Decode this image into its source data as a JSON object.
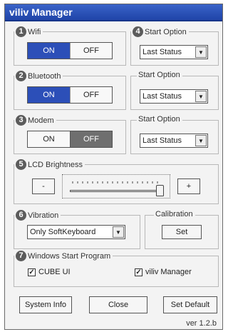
{
  "title": "viliv Manager",
  "wifi": {
    "num": "1",
    "label": "Wifi",
    "on": "ON",
    "off": "OFF",
    "state": "on"
  },
  "wifi_start": {
    "num": "4",
    "label": "Start Option",
    "value": "Last Status"
  },
  "bluetooth": {
    "num": "2",
    "label": "Bluetooth",
    "on": "ON",
    "off": "OFF",
    "state": "on"
  },
  "bluetooth_start": {
    "label": "Start Option",
    "value": "Last Status"
  },
  "modem": {
    "num": "3",
    "label": "Modem",
    "on": "ON",
    "off": "OFF",
    "state": "off"
  },
  "modem_start": {
    "label": "Start Option",
    "value": "Last Status"
  },
  "lcd": {
    "num": "5",
    "label": "LCD Brightness",
    "minus": "-",
    "plus": "+",
    "level": 1.0
  },
  "vibration": {
    "num": "6",
    "label": "Vibration",
    "value": "Only SoftKeyboard"
  },
  "calibration": {
    "label": "Calibration",
    "button": "Set"
  },
  "startup": {
    "num": "7",
    "label": "Windows Start Program",
    "items": [
      {
        "label": "CUBE UI",
        "checked": true
      },
      {
        "label": "viliv Manager",
        "checked": true
      }
    ]
  },
  "buttons": {
    "sysinfo": "System Info",
    "close": "Close",
    "default": "Set Default"
  },
  "version": "ver 1.2.b",
  "icons": {
    "dropdown": "dropdown-arrow-icon",
    "check": "checkmark-icon"
  },
  "colors": {
    "title": "#2a50b8",
    "on_active": "#2c4fb8",
    "off_active": "#6f6f6f"
  }
}
